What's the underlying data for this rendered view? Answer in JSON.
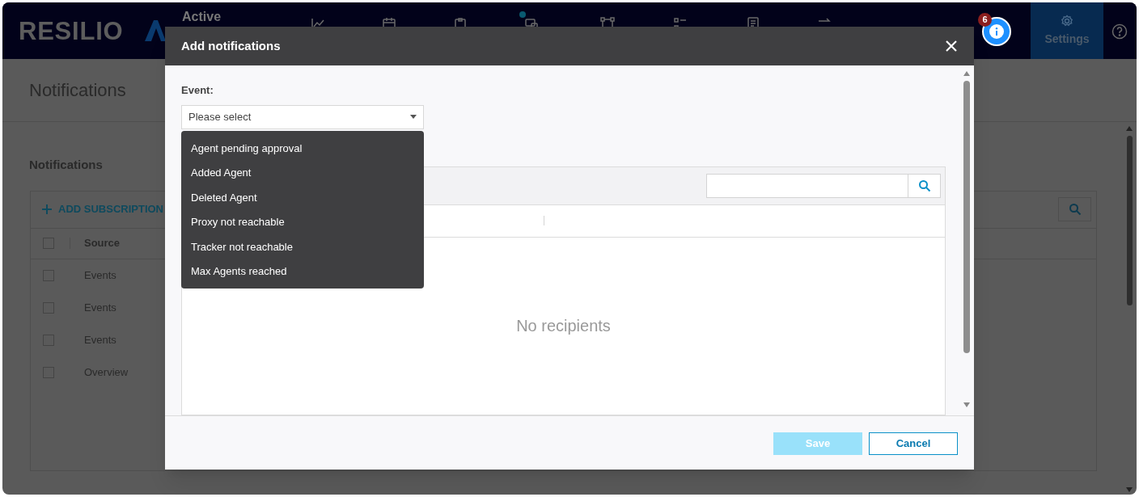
{
  "header": {
    "logo": "RESILIO",
    "product": "Active",
    "nav_items": [
      {
        "kind": "chart",
        "dot": false
      },
      {
        "kind": "calendar",
        "dot": false
      },
      {
        "kind": "clipboard",
        "dot": false
      },
      {
        "kind": "devices",
        "dot": true
      },
      {
        "kind": "nodes",
        "dot": false
      },
      {
        "kind": "list",
        "dot": false
      },
      {
        "kind": "document",
        "dot": false
      },
      {
        "kind": "transfer",
        "dot": false
      }
    ],
    "notification_count": "6",
    "settings_tab": {
      "label": "Settings",
      "selected": true
    }
  },
  "page": {
    "title": "Notifications",
    "section_title": "Notifications",
    "add_button": "ADD SUBSCRIPTION",
    "columns": [
      "Source"
    ],
    "select_all_checked": false,
    "rows": [
      {
        "source": "Events",
        "checked": false
      },
      {
        "source": "Events",
        "checked": false
      },
      {
        "source": "Events",
        "checked": false
      },
      {
        "source": "Overview",
        "checked": false
      }
    ]
  },
  "dialog": {
    "title": "Add notifications",
    "event_label": "Event:",
    "event_select": {
      "placeholder": "Please select",
      "expanded": true
    },
    "options": [
      "Agent pending approval",
      "Added Agent",
      "Deleted Agent",
      "Proxy not reachable",
      "Tracker not reachable",
      "Max Agents reached"
    ],
    "empty_message": "No recipients",
    "buttons": [
      {
        "label": "Save",
        "kind": "primary",
        "disabled": true
      },
      {
        "label": "Cancel",
        "kind": "secondary",
        "disabled": false
      }
    ]
  }
}
